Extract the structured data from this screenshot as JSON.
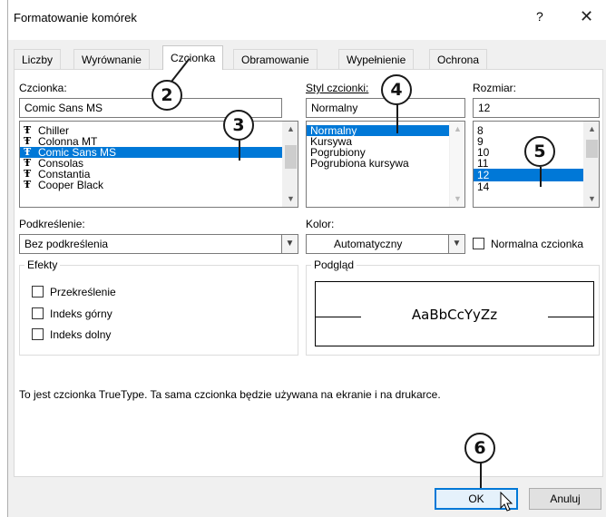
{
  "window": {
    "title": "Formatowanie komórek",
    "help": "?",
    "close": "✕"
  },
  "tabs": [
    {
      "label": "Liczby"
    },
    {
      "label": "Wyrównanie"
    },
    {
      "label": "Czcionka"
    },
    {
      "label": "Obramowanie"
    },
    {
      "label": "Wypełnienie"
    },
    {
      "label": "Ochrona"
    }
  ],
  "font": {
    "label": "Czcionka:",
    "value": "Comic Sans MS",
    "items": [
      "Chiller",
      "Colonna MT",
      "Comic Sans MS",
      "Consolas",
      "Constantia",
      "Cooper Black"
    ],
    "tt_glyph": "Ŧ"
  },
  "style": {
    "label": "Styl czcionki:",
    "value": "Normalny",
    "items": [
      "Normalny",
      "Kursywa",
      "Pogrubiony",
      "Pogrubiona kursywa"
    ]
  },
  "size": {
    "label": "Rozmiar:",
    "value": "12",
    "items": [
      "8",
      "9",
      "10",
      "11",
      "12",
      "14"
    ]
  },
  "underline": {
    "label": "Podkreślenie:",
    "value": "Bez podkreślenia"
  },
  "color": {
    "label": "Kolor:",
    "value": "Automatyczny"
  },
  "normal_font": {
    "label": "Normalna czcionka"
  },
  "effects": {
    "label": "Efekty",
    "items": [
      "Przekreślenie",
      "Indeks górny",
      "Indeks dolny"
    ]
  },
  "preview": {
    "label": "Podgląd",
    "sample": "AaBbCcYyZz"
  },
  "info_text": "To jest czcionka TrueType. Ta sama czcionka będzie używana na ekranie i na drukarce.",
  "buttons": {
    "ok": "OK",
    "cancel": "Anuluj"
  },
  "callouts": [
    "2",
    "3",
    "4",
    "5",
    "6"
  ],
  "colors": {
    "selection": "#0078d7",
    "default_button_border": "#0078d7"
  }
}
